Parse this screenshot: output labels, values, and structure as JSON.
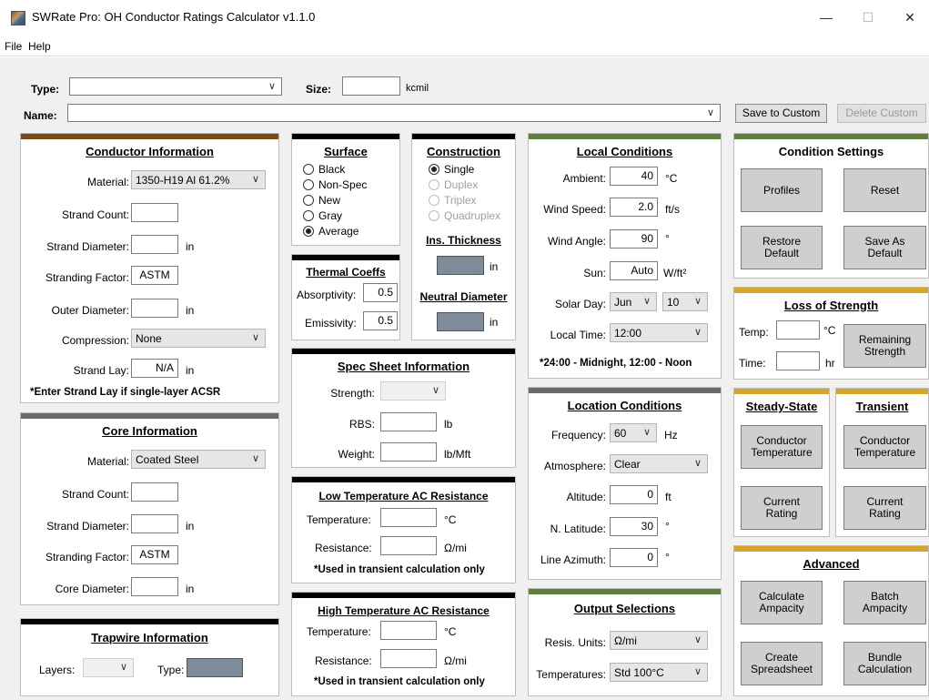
{
  "window": {
    "title": "SWRate Pro: OH Conductor Ratings Calculator v1.1.0",
    "minimize": "—",
    "maximize": "☐",
    "close": "✕"
  },
  "menu": [
    "File",
    "Help"
  ],
  "top": {
    "type_label": "Type:",
    "type_value": "",
    "size_label": "Size:",
    "size_value": "",
    "size_unit": "kcmil",
    "name_label": "Name:",
    "name_value": "",
    "save_custom": "Save to Custom",
    "delete_custom": "Delete Custom"
  },
  "conductor": {
    "title": "Conductor Information",
    "material_label": "Material:",
    "material_value": "1350-H19 Al 61.2%",
    "strand_count_label": "Strand Count:",
    "strand_count_value": "",
    "strand_diameter_label": "Strand Diameter:",
    "strand_diameter_value": "",
    "strand_diameter_unit": "in",
    "stranding_factor_label": "Stranding Factor:",
    "stranding_factor_value": "ASTM",
    "outer_diameter_label": "Outer Diameter:",
    "outer_diameter_value": "",
    "outer_diameter_unit": "in",
    "compression_label": "Compression:",
    "compression_value": "None",
    "strand_lay_label": "Strand Lay:",
    "strand_lay_value": "N/A",
    "strand_lay_unit": "in",
    "note": "*Enter Strand Lay if single-layer ACSR"
  },
  "core": {
    "title": "Core Information",
    "material_label": "Material:",
    "material_value": "Coated Steel",
    "strand_count_label": "Strand Count:",
    "strand_count_value": "",
    "strand_diameter_label": "Strand Diameter:",
    "strand_diameter_value": "",
    "strand_diameter_unit": "in",
    "stranding_factor_label": "Stranding Factor:",
    "stranding_factor_value": "ASTM",
    "core_diameter_label": "Core Diameter:",
    "core_diameter_value": "",
    "core_diameter_unit": "in"
  },
  "trapwire": {
    "title": "Trapwire Information",
    "layers_label": "Layers:",
    "layers_value": "",
    "type_label": "Type:"
  },
  "surface": {
    "title": "Surface",
    "options": [
      "Black",
      "Non-Spec",
      "New",
      "Gray",
      "Average"
    ],
    "selected": "Average"
  },
  "construction": {
    "title": "Construction",
    "options": [
      "Single",
      "Duplex",
      "Triplex",
      "Quadruplex"
    ],
    "selected": "Single",
    "ins_thickness_label": "Ins. Thickness",
    "ins_thickness_unit": "in",
    "neutral_diameter_label": "Neutral Diameter",
    "neutral_diameter_unit": "in"
  },
  "thermal": {
    "title": "Thermal Coeffs",
    "absorptivity_label": "Absorptivity:",
    "absorptivity_value": "0.5",
    "emissivity_label": "Emissivity:",
    "emissivity_value": "0.5"
  },
  "spec": {
    "title": "Spec Sheet Information",
    "strength_label": "Strength:",
    "strength_value": "",
    "rbs_label": "RBS:",
    "rbs_value": "",
    "rbs_unit": "lb",
    "weight_label": "Weight:",
    "weight_value": "",
    "weight_unit": "lb/Mft"
  },
  "low_ac": {
    "title": "Low Temperature AC Resistance",
    "temperature_label": "Temperature:",
    "temperature_value": "",
    "temperature_unit": "°C",
    "resistance_label": "Resistance:",
    "resistance_value": "",
    "resistance_unit": "Ω/mi",
    "note": "*Used in transient calculation only"
  },
  "high_ac": {
    "title": "High Temperature AC Resistance",
    "temperature_label": "Temperature:",
    "temperature_value": "",
    "temperature_unit": "°C",
    "resistance_label": "Resistance:",
    "resistance_value": "",
    "resistance_unit": "Ω/mi",
    "note": "*Used in transient calculation only"
  },
  "local": {
    "title": "Local Conditions",
    "ambient_label": "Ambient:",
    "ambient_value": "40",
    "ambient_unit": "°C",
    "wind_speed_label": "Wind Speed:",
    "wind_speed_value": "2.0",
    "wind_speed_unit": "ft/s",
    "wind_angle_label": "Wind Angle:",
    "wind_angle_value": "90",
    "wind_angle_unit": "°",
    "sun_label": "Sun:",
    "sun_value": "Auto",
    "sun_unit": "W/ft²",
    "solar_day_label": "Solar Day:",
    "solar_month": "Jun",
    "solar_day": "10",
    "local_time_label": "Local Time:",
    "local_time_value": "12:00",
    "note": "*24:00 - Midnight, 12:00 - Noon"
  },
  "location": {
    "title": "Location Conditions",
    "frequency_label": "Frequency:",
    "frequency_value": "60",
    "frequency_unit": "Hz",
    "atmosphere_label": "Atmosphere:",
    "atmosphere_value": "Clear",
    "altitude_label": "Altitude:",
    "altitude_value": "0",
    "altitude_unit": "ft",
    "latitude_label": "N. Latitude:",
    "latitude_value": "30",
    "latitude_unit": "°",
    "azimuth_label": "Line Azimuth:",
    "azimuth_value": "0",
    "azimuth_unit": "°"
  },
  "output": {
    "title": "Output Selections",
    "resis_units_label": "Resis. Units:",
    "resis_units_value": "Ω/mi",
    "temperatures_label": "Temperatures:",
    "temperatures_value": "Std 100°C"
  },
  "condition_settings": {
    "title": "Condition Settings",
    "profiles": "Profiles",
    "reset": "Reset",
    "restore_default": "Restore\nDefault",
    "save_as_default": "Save As\nDefault"
  },
  "loss_of_strength": {
    "title": "Loss of Strength",
    "temp_label": "Temp:",
    "temp_value": "",
    "temp_unit": "°C",
    "time_label": "Time:",
    "time_value": "",
    "time_unit": "hr",
    "remaining_strength": "Remaining\nStrength"
  },
  "steady_state": {
    "title": "Steady-State",
    "conductor_temperature": "Conductor\nTemperature",
    "current_rating": "Current\nRating"
  },
  "transient": {
    "title": "Transient",
    "conductor_temperature": "Conductor\nTemperature",
    "current_rating": "Current\nRating"
  },
  "advanced": {
    "title": "Advanced",
    "calculate_ampacity": "Calculate\nAmpacity",
    "batch_ampacity": "Batch\nAmpacity",
    "create_spreadsheet": "Create\nSpreadsheet",
    "bundle_calculation": "Bundle\nCalculation"
  },
  "colors": {
    "brown": "#7b4a1c",
    "gray": "#6b6b6b",
    "black": "#000000",
    "green": "#5f7f3f",
    "gold": "#d4a52a",
    "field_blue": "#7e8b99"
  },
  "icons": {
    "chevron": "chevron-down-icon",
    "app": "app-icon"
  }
}
